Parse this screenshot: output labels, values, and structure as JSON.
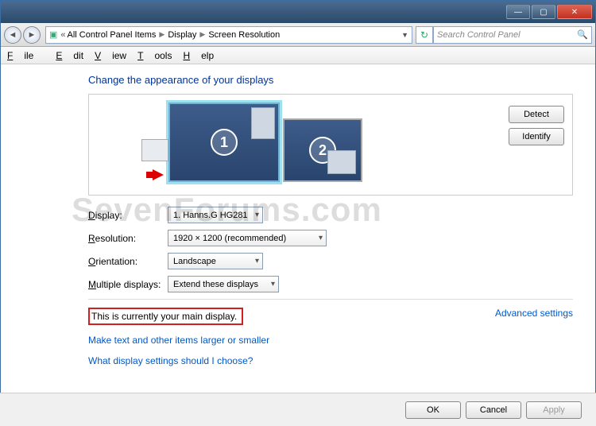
{
  "titlebar": {
    "min": "—",
    "max": "▢",
    "close": "✕"
  },
  "nav": {
    "crumbs": [
      "All Control Panel Items",
      "Display",
      "Screen Resolution"
    ],
    "search_placeholder": "Search Control Panel"
  },
  "menu": {
    "file": "File",
    "edit": "Edit",
    "view": "View",
    "tools": "Tools",
    "help": "Help"
  },
  "heading": "Change the appearance of your displays",
  "monitor1_num": "1",
  "monitor2_num": "2",
  "buttons": {
    "detect": "Detect",
    "identify": "Identify"
  },
  "form": {
    "display_label": "Display:",
    "display_value": "1. Hanns.G HG281",
    "resolution_label": "Resolution:",
    "resolution_value": "1920 × 1200 (recommended)",
    "orientation_label": "Orientation:",
    "orientation_value": "Landscape",
    "multi_label": "Multiple displays:",
    "multi_value": "Extend these displays"
  },
  "main_display_text": "This is currently your main display.",
  "advanced": "Advanced settings",
  "link1": "Make text and other items larger or smaller",
  "link2": "What display settings should I choose?",
  "footer": {
    "ok": "OK",
    "cancel": "Cancel",
    "apply": "Apply"
  },
  "watermark": "SevenForums.com"
}
